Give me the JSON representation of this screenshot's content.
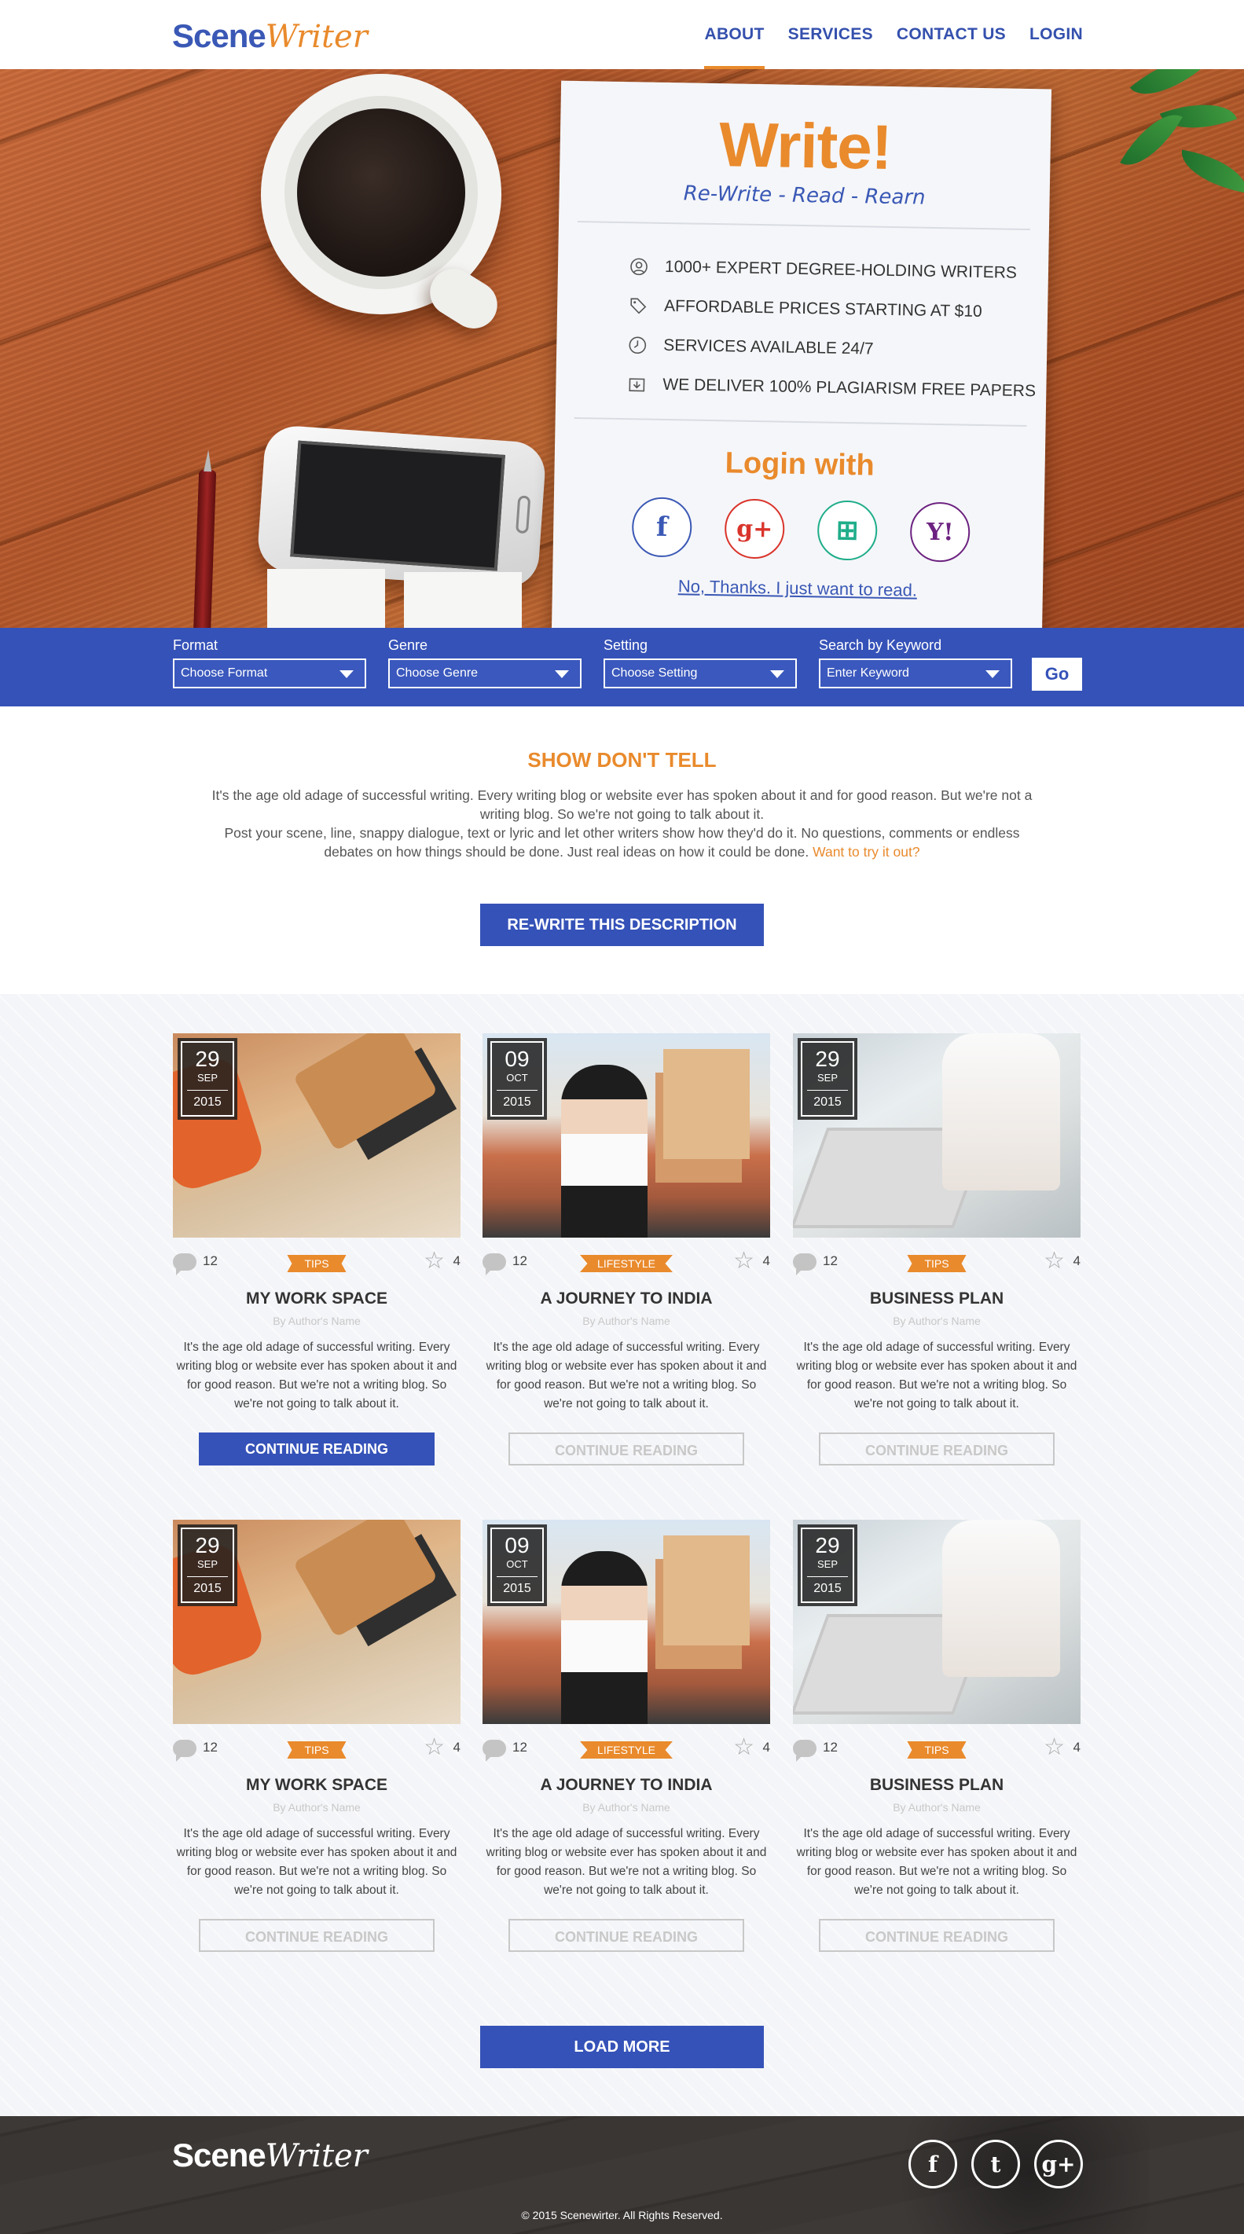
{
  "header": {
    "logo": {
      "part1": "Scene",
      "part2": "Writer"
    },
    "nav": [
      {
        "label": "ABOUT",
        "active": true
      },
      {
        "label": "SERVICES",
        "active": false
      },
      {
        "label": "CONTACT US",
        "active": false
      },
      {
        "label": "LOGIN",
        "active": false
      }
    ]
  },
  "hero": {
    "title": "Write!",
    "subtitle": "Re-Write - Read - Rearn",
    "features": [
      {
        "icon": "user-icon",
        "text": "1000+ EXPERT DEGREE-HOLDING WRITERS"
      },
      {
        "icon": "price-tag-icon",
        "text": "AFFORDABLE PRICES STARTING AT $10"
      },
      {
        "icon": "clock-icon",
        "text": "SERVICES AVAILABLE 24/7"
      },
      {
        "icon": "download-icon",
        "text": "WE DELIVER 100% PLAGIARISM FREE PAPERS"
      }
    ],
    "login_with": "Login with",
    "social_logins": [
      {
        "name": "facebook",
        "glyph": "f"
      },
      {
        "name": "google-plus",
        "glyph": "g+"
      },
      {
        "name": "windows",
        "glyph": "⊞"
      },
      {
        "name": "yahoo",
        "glyph": "Y!"
      }
    ],
    "no_thanks": "No, Thanks. I just want to read."
  },
  "filters": {
    "format": {
      "label": "Format",
      "value": "Choose Format"
    },
    "genre": {
      "label": "Genre",
      "value": "Choose Genre"
    },
    "setting": {
      "label": "Setting",
      "value": "Choose Setting"
    },
    "keyword": {
      "label": "Search by Keyword",
      "value": "Enter Keyword"
    },
    "go": "Go"
  },
  "intro": {
    "title": "SHOW DON'T TELL",
    "line1": "It's the age old adage of successful writing. Every writing blog or website ever has spoken about it and for good reason. But we're not a writing blog. So we're not going to talk about it.",
    "line2": "Post your scene, line, snappy dialogue, text or lyric and let other writers show how they'd do it. No questions, comments or endless debates on how things should be done. Just real ideas on how it could be done.",
    "link": "Want to try it out?",
    "button": "RE-WRITE THIS DESCRIPTION"
  },
  "posts": [
    {
      "day": "29",
      "month": "SEP",
      "year": "2015",
      "comments": "12",
      "tag": "TIPS",
      "stars": "4",
      "title": "MY WORK SPACE",
      "author": "By Author's Name",
      "excerpt": "It's the age old adage of successful writing. Every writing blog or website ever has spoken about it and for good reason. But we're not a writing blog. So we're not going to talk about it.",
      "button": "CONTINUE READING",
      "photo": "desk"
    },
    {
      "day": "09",
      "month": "OCT",
      "year": "2015",
      "comments": "12",
      "tag": "LIFESTYLE",
      "stars": "4",
      "title": "A JOURNEY TO INDIA",
      "author": "By Author's Name",
      "excerpt": "It's the age old adage of successful writing. Every writing blog or website ever has spoken about it and for good reason. But we're not a writing blog. So we're not going to talk about it.",
      "button": "CONTINUE READING",
      "photo": "travel"
    },
    {
      "day": "29",
      "month": "SEP",
      "year": "2015",
      "comments": "12",
      "tag": "TIPS",
      "stars": "4",
      "title": "BUSINESS PLAN",
      "author": "By Author's Name",
      "excerpt": "It's the age old adage of successful writing. Every writing blog or website ever has spoken about it and for good reason. But we're not a writing blog. So we're not going to talk about it.",
      "button": "CONTINUE READING",
      "photo": "laptop"
    },
    {
      "day": "29",
      "month": "SEP",
      "year": "2015",
      "comments": "12",
      "tag": "TIPS",
      "stars": "4",
      "title": "MY WORK SPACE",
      "author": "By Author's Name",
      "excerpt": "It's the age old adage of successful writing. Every writing blog or website ever has spoken about it and for good reason. But we're not a writing blog. So we're not going to talk about it.",
      "button": "CONTINUE READING",
      "photo": "desk"
    },
    {
      "day": "09",
      "month": "OCT",
      "year": "2015",
      "comments": "12",
      "tag": "LIFESTYLE",
      "stars": "4",
      "title": "A JOURNEY TO INDIA",
      "author": "By Author's Name",
      "excerpt": "It's the age old adage of successful writing. Every writing blog or website ever has spoken about it and for good reason. But we're not a writing blog. So we're not going to talk about it.",
      "button": "CONTINUE READING",
      "photo": "travel"
    },
    {
      "day": "29",
      "month": "SEP",
      "year": "2015",
      "comments": "12",
      "tag": "TIPS",
      "stars": "4",
      "title": "BUSINESS PLAN",
      "author": "By Author's Name",
      "excerpt": "It's the age old adage of successful writing. Every writing blog or website ever has spoken about it and for good reason. But we're not a writing blog. So we're not going to talk about it.",
      "button": "CONTINUE READING",
      "photo": "laptop"
    }
  ],
  "load_more": "LOAD MORE",
  "footer": {
    "logo": {
      "part1": "Scene",
      "part2": "Writer"
    },
    "social": [
      {
        "name": "facebook",
        "glyph": "f"
      },
      {
        "name": "twitter",
        "glyph": "t"
      },
      {
        "name": "google-plus",
        "glyph": "g+"
      }
    ],
    "copyright": "© 2015 Scenewirter. All Rights Reserved."
  },
  "colors": {
    "accent": "#e98a2c",
    "brand_blue": "#3552b8"
  }
}
